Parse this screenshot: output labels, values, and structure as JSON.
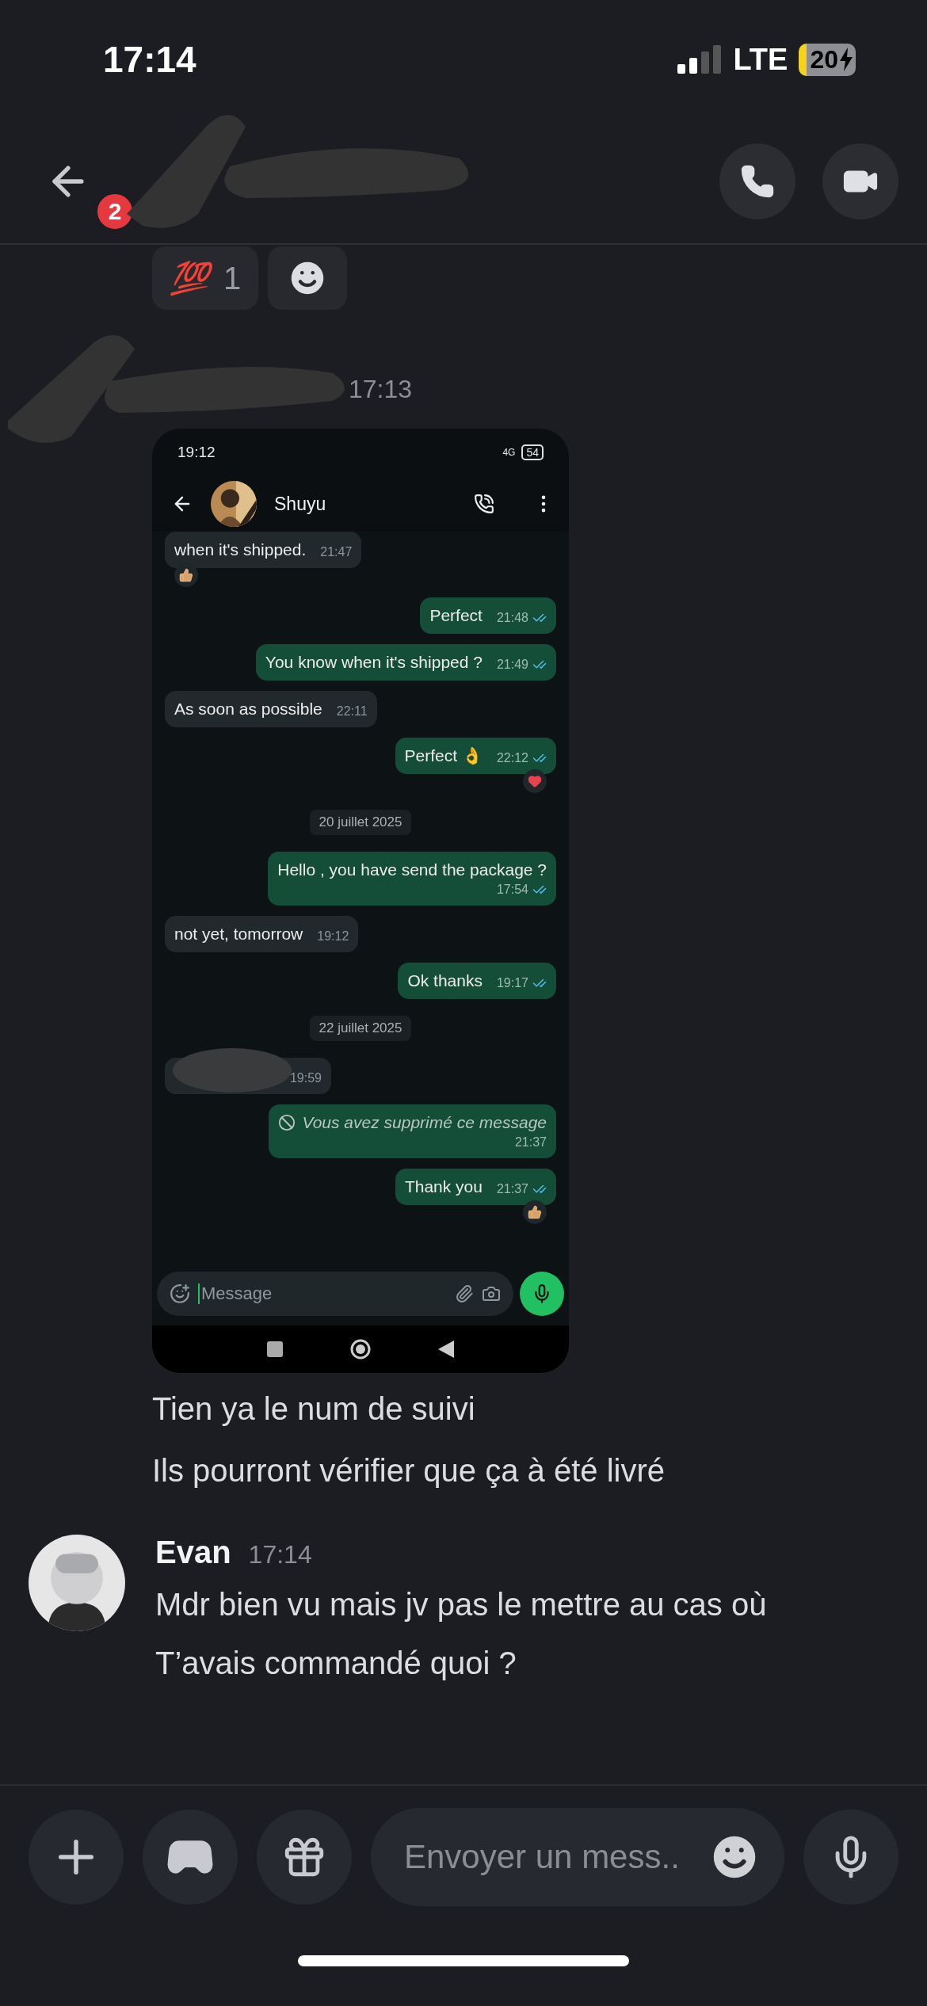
{
  "status_bar": {
    "time": "17:14",
    "network": "LTE",
    "battery": "20"
  },
  "header": {
    "back_badge": "2"
  },
  "reactions": [
    {
      "emoji": "💯",
      "count": "1"
    }
  ],
  "shared_message": {
    "time": "17:13",
    "screenshot": {
      "status_time": "19:12",
      "battery": "54",
      "network": "4G",
      "contact": "Shuyu",
      "messages": [
        {
          "kind": "incoming",
          "text": "when it's shipped.",
          "time": "21:47",
          "reaction": {
            "kind": "thumbs"
          }
        },
        {
          "kind": "outgoing",
          "text": "Perfect",
          "time": "21:48",
          "read": true
        },
        {
          "kind": "outgoing",
          "text": "You know when it's shipped ?",
          "time": "21:49",
          "read": true
        },
        {
          "kind": "incoming",
          "text": "As soon as possible",
          "time": "22:11"
        },
        {
          "kind": "outgoing",
          "text": "Perfect 👌",
          "time": "22:12",
          "read": true,
          "reaction": {
            "kind": "heart"
          }
        },
        {
          "kind": "date",
          "text": "20 juillet 2025"
        },
        {
          "kind": "outgoing",
          "text": "Hello , you have send the package ?",
          "time": "17:54",
          "read": true,
          "stacked": true
        },
        {
          "kind": "incoming",
          "text": "not yet, tomorrow",
          "time": "19:12"
        },
        {
          "kind": "outgoing",
          "text": "Ok thanks",
          "time": "19:17",
          "read": true
        },
        {
          "kind": "date",
          "text": "22 juillet 2025"
        },
        {
          "kind": "redacted",
          "time": "19:59"
        },
        {
          "kind": "deleted",
          "text": "Vous avez supprimé ce message",
          "time": "21:37"
        },
        {
          "kind": "outgoing",
          "text": "Thank you",
          "time": "21:37",
          "read": true,
          "reaction": {
            "kind": "thumbs"
          }
        }
      ],
      "input_placeholder": "Message"
    },
    "lines": [
      "Tien ya le num de suivi",
      "Ils pourront vérifier que ça à été livré"
    ]
  },
  "next_message": {
    "author": "Evan",
    "time": "17:14",
    "lines": [
      "Mdr bien vu mais jv pas le mettre au cas où",
      "T’avais commandé quoi ?"
    ]
  },
  "composer": {
    "placeholder": "Envoyer un mess.."
  }
}
